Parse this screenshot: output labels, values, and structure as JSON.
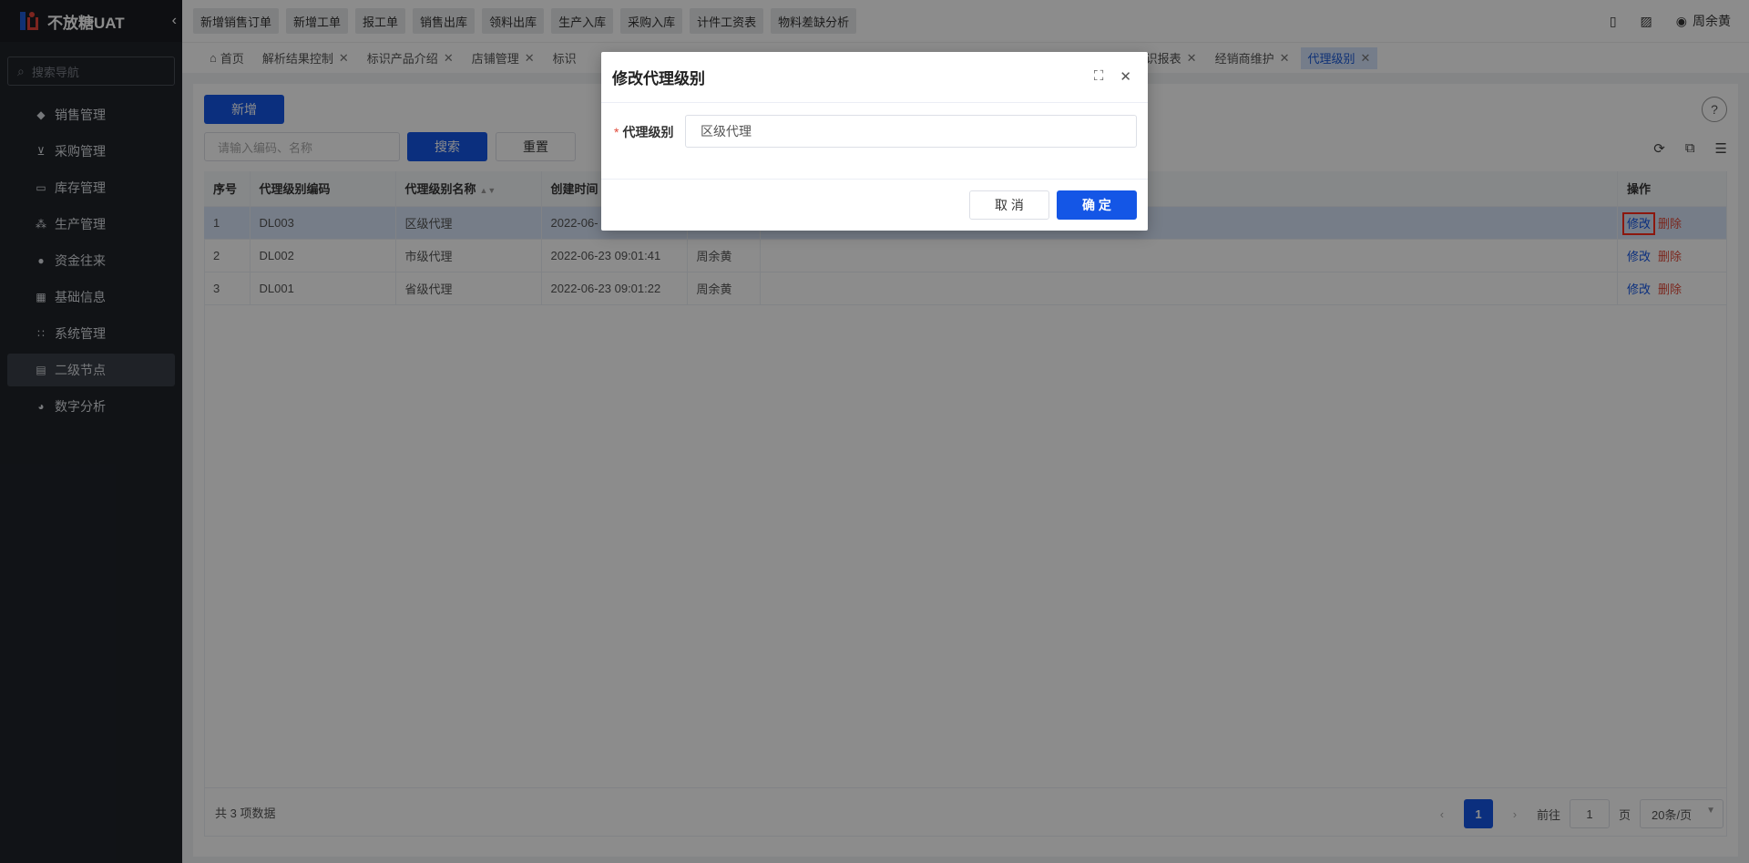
{
  "app": {
    "title": "不放糖UAT"
  },
  "sidebar": {
    "search_placeholder": "搜索导航",
    "items": [
      {
        "label": "销售管理",
        "icon": "tag-icon"
      },
      {
        "label": "采购管理",
        "icon": "cart-icon"
      },
      {
        "label": "库存管理",
        "icon": "box-icon"
      },
      {
        "label": "生产管理",
        "icon": "cluster-icon"
      },
      {
        "label": "资金往来",
        "icon": "coin-icon"
      },
      {
        "label": "基础信息",
        "icon": "grid-icon"
      },
      {
        "label": "系统管理",
        "icon": "apps-icon"
      },
      {
        "label": "二级节点",
        "icon": "doc-icon"
      },
      {
        "label": "数字分析",
        "icon": "pie-icon"
      }
    ]
  },
  "topbar": {
    "quick_links": [
      "新增销售订单",
      "新增工单",
      "报工单",
      "销售出库",
      "领料出库",
      "生产入库",
      "采购入库",
      "计件工资表",
      "物料差缺分析"
    ],
    "user_name": "周余黄"
  },
  "tabs": [
    {
      "label": "首页"
    },
    {
      "label": "解析结果控制"
    },
    {
      "label": "标识产品介绍"
    },
    {
      "label": "店铺管理"
    },
    {
      "label": "标识"
    },
    {
      "label": "标识报表"
    },
    {
      "label": "经销商维护"
    },
    {
      "label": "代理级别"
    }
  ],
  "toolbar": {
    "new_label": "新增",
    "search_placeholder": "请输入编码、名称",
    "search_label": "搜索",
    "reset_label": "重置"
  },
  "table": {
    "columns": [
      "序号",
      "代理级别编码",
      "代理级别名称",
      "创建时间",
      "",
      "",
      "操作"
    ],
    "rows": [
      {
        "no": "1",
        "code": "DL003",
        "name": "区级代理",
        "time": "2022-06-",
        "creator": ""
      },
      {
        "no": "2",
        "code": "DL002",
        "name": "市级代理",
        "time": "2022-06-23 09:01:41",
        "creator": "周余黄"
      },
      {
        "no": "3",
        "code": "DL001",
        "name": "省级代理",
        "time": "2022-06-23 09:01:22",
        "creator": "周余黄"
      }
    ],
    "edit_label": "修改",
    "delete_label": "删除"
  },
  "footer": {
    "total": "共 3 项数据",
    "current_page": "1",
    "goto_label": "前往",
    "goto_value": "1",
    "page_label": "页",
    "page_size": "20条/页"
  },
  "modal": {
    "title": "修改代理级别",
    "field_label": "代理级别",
    "field_value": "区级代理",
    "cancel_label": "取 消",
    "ok_label": "确 定"
  }
}
